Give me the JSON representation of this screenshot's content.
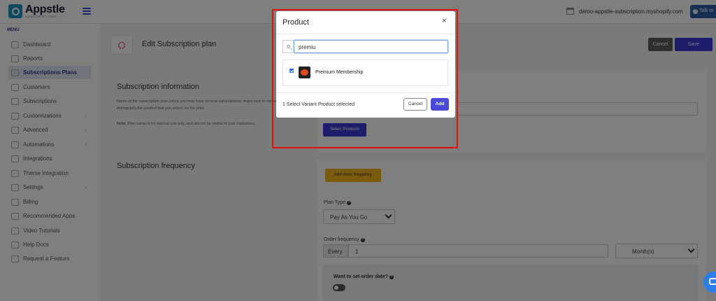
{
  "header": {
    "brand_name": "Appstle",
    "brand_sub": "SUBSCRIPTIONS",
    "store_name": "demo-appstle-subscription.myshopify.com",
    "talk_label": "Talk to"
  },
  "sidebar": {
    "menu_label": "MENU",
    "items": [
      {
        "label": "Dashboard"
      },
      {
        "label": "Reports"
      },
      {
        "label": "Subscriptions Plans"
      },
      {
        "label": "Customers"
      },
      {
        "label": "Subscriptions"
      },
      {
        "label": "Customizations"
      },
      {
        "label": "Advanced"
      },
      {
        "label": "Automations"
      },
      {
        "label": "Integrations"
      },
      {
        "label": "Theme Integration"
      },
      {
        "label": "Settings"
      },
      {
        "label": "Billing"
      },
      {
        "label": "Recommended Apps"
      },
      {
        "label": "Video Tutorials"
      },
      {
        "label": "Help Docs"
      },
      {
        "label": "Request a Feature"
      }
    ]
  },
  "page": {
    "title": "Edit Subscription plan",
    "cancel_label": "Cancel",
    "save_label": "Save"
  },
  "subscription_info": {
    "title": "Subscription information",
    "description": "Name of the subscription plan (since you may have several subscriptions, make sure to name them to distinguish) the product that you select, for the plan.",
    "note_prefix": "Note:",
    "note": "Plan name is for internal use only, and will not be visible to your customers.",
    "select_products_label": "Select Products"
  },
  "subscription_frequency": {
    "title": "Subscription frequency",
    "add_more_label": "Add more frequency",
    "plan_type_label": "Plan Type",
    "plan_type_value": "Pay As You Go",
    "order_frequency_label": "Order frequency",
    "every_label": "Every",
    "frequency_value": "1",
    "unit_value": "Month(s)",
    "order_date_label": "Want to set order date?"
  },
  "modal": {
    "title": "Product",
    "close": "×",
    "search_value": "premiu",
    "products": [
      {
        "name": "Premium Membership",
        "checked": true
      }
    ],
    "selected_count": "1 Select Variant Product selected",
    "cancel_label": "Cancel",
    "add_label": "Add"
  },
  "colors": {
    "accent": "#3a3bd6",
    "highlight": "#e01010",
    "brand": "#1a8fc4"
  }
}
